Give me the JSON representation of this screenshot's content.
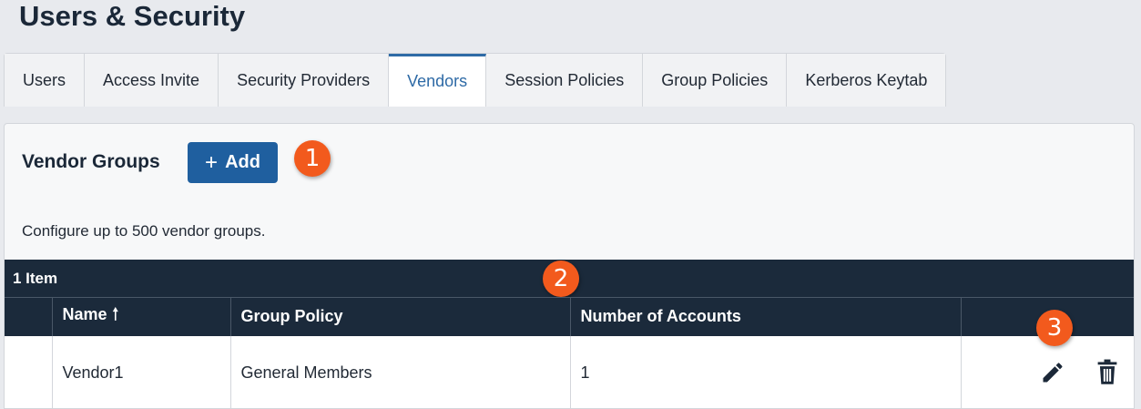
{
  "page": {
    "title": "Users & Security"
  },
  "tabs": [
    {
      "label": "Users"
    },
    {
      "label": "Access Invite"
    },
    {
      "label": "Security Providers"
    },
    {
      "label": "Vendors",
      "active": true
    },
    {
      "label": "Session Policies"
    },
    {
      "label": "Group Policies"
    },
    {
      "label": "Kerberos Keytab"
    }
  ],
  "section": {
    "title": "Vendor Groups",
    "add_label": "Add",
    "description": "Configure up to 500 vendor groups."
  },
  "callouts": [
    "1",
    "2",
    "3"
  ],
  "grid": {
    "count_label": "1 Item",
    "columns": [
      "Name",
      "Group Policy",
      "Number of Accounts"
    ],
    "rows": [
      {
        "name": "Vendor1",
        "group_policy": "General Members",
        "accounts": "1"
      }
    ]
  },
  "icons": {
    "sort": "arrow-up-icon",
    "edit": "pencil-icon",
    "delete": "trash-icon"
  },
  "colors": {
    "primary": "#1f5f9f",
    "header": "#1b2a3b",
    "callout": "#f25a1d",
    "active_tab": "#2e6aa6"
  }
}
